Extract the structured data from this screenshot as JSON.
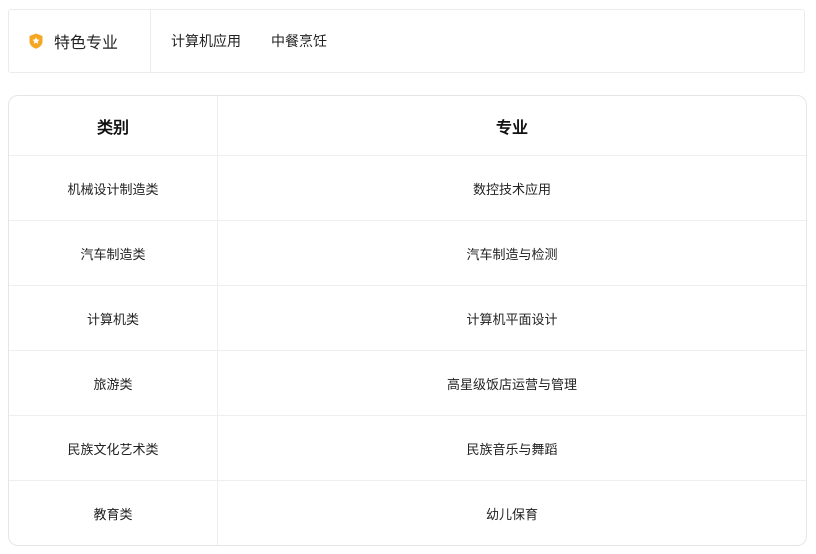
{
  "featured": {
    "title": "特色专业",
    "icon": "badge-star-icon",
    "accent_color": "#f5a623",
    "tags": [
      "计算机应用",
      "中餐烹饪"
    ]
  },
  "table": {
    "headers": {
      "category": "类别",
      "major": "专业"
    },
    "rows": [
      {
        "category": "机械设计制造类",
        "major": "数控技术应用"
      },
      {
        "category": "汽车制造类",
        "major": "汽车制造与检测"
      },
      {
        "category": "计算机类",
        "major": "计算机平面设计"
      },
      {
        "category": "旅游类",
        "major": "高星级饭店运营与管理"
      },
      {
        "category": "民族文化艺术类",
        "major": "民族音乐与舞蹈"
      },
      {
        "category": "教育类",
        "major": "幼儿保育"
      }
    ]
  }
}
